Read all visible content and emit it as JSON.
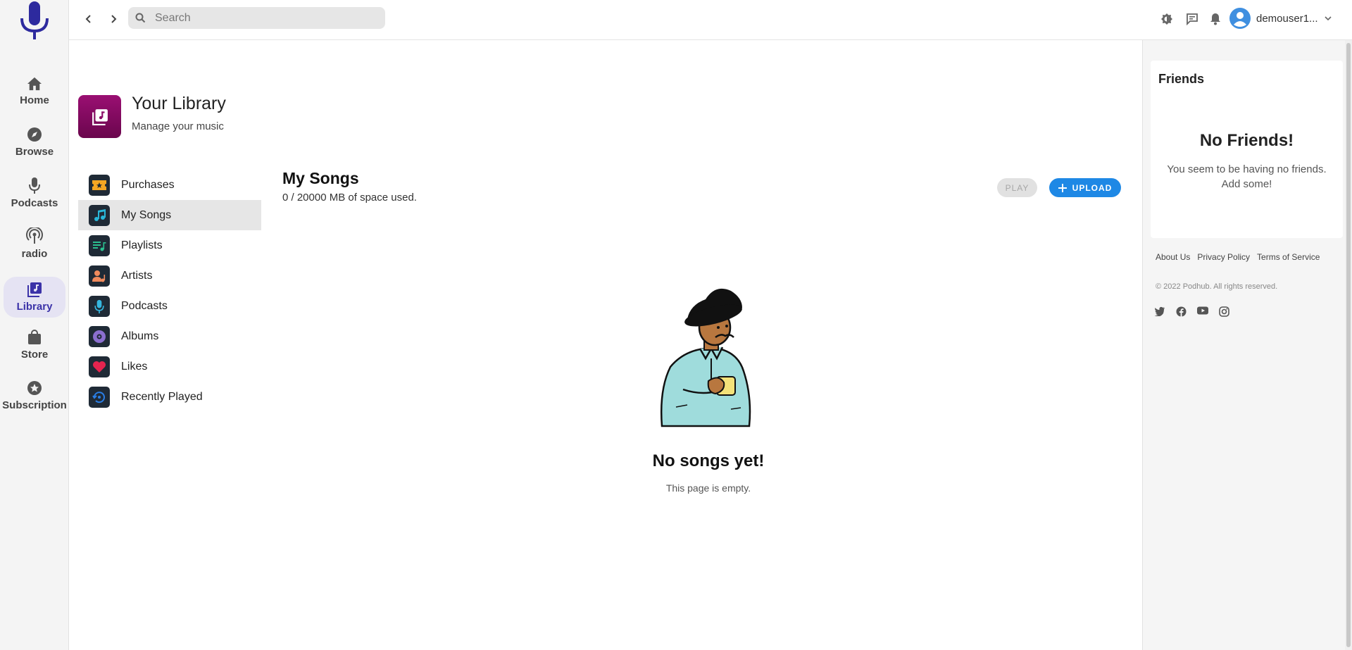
{
  "rail": {
    "logo": "microphone-logo",
    "items": [
      {
        "label": "Home",
        "icon": "home-icon"
      },
      {
        "label": "Browse",
        "icon": "compass-icon"
      },
      {
        "label": "Podcasts",
        "icon": "mic-icon"
      },
      {
        "label": "radio",
        "icon": "radio-icon"
      },
      {
        "label": "Library",
        "icon": "library-icon",
        "active": true
      },
      {
        "label": "Store",
        "icon": "shopping-bag-icon"
      },
      {
        "label": "Subscription",
        "icon": "star-circle-icon"
      }
    ]
  },
  "topbar": {
    "search_placeholder": "Search",
    "username": "demouser1...",
    "icons": [
      "brightness-icon",
      "chat-icon",
      "bell-icon",
      "avatar-icon",
      "chevron-down-icon"
    ]
  },
  "library": {
    "title": "Your Library",
    "subtitle": "Manage your music",
    "menu": [
      {
        "label": "Purchases",
        "icon": "ticket-icon",
        "color": "#f5a623"
      },
      {
        "label": "My Songs",
        "icon": "music-note-icon",
        "color": "#29b6d8",
        "active": true
      },
      {
        "label": "Playlists",
        "icon": "playlist-icon",
        "color": "#2bbf8f"
      },
      {
        "label": "Artists",
        "icon": "artist-icon",
        "color": "#f08a5d"
      },
      {
        "label": "Podcasts",
        "icon": "mic-icon",
        "color": "#36b7e0"
      },
      {
        "label": "Albums",
        "icon": "album-icon",
        "color": "#8b6fd0"
      },
      {
        "label": "Likes",
        "icon": "heart-icon",
        "color": "#e5244f"
      },
      {
        "label": "Recently Played",
        "icon": "history-icon",
        "color": "#2a7ee6"
      }
    ]
  },
  "songs": {
    "title": "My Songs",
    "usage": "0 / 20000 MB of space used.",
    "play_label": "PLAY",
    "upload_label": "UPLOAD",
    "empty_title": "No songs yet!",
    "empty_text": "This page is empty."
  },
  "friends": {
    "title": "Friends",
    "empty_title": "No Friends!",
    "empty_text": "You seem to be having no friends. Add some!"
  },
  "footer": {
    "links": [
      "About Us",
      "Privacy Policy",
      "Terms of Service"
    ],
    "copyright": "© 2022 Podhub. All rights reserved.",
    "socials": [
      "twitter-icon",
      "facebook-icon",
      "youtube-icon",
      "instagram-icon"
    ]
  },
  "colors": {
    "accent": "#1e88e5",
    "brand": "#3b32a8",
    "library_gradient_top": "#9a0f72"
  }
}
